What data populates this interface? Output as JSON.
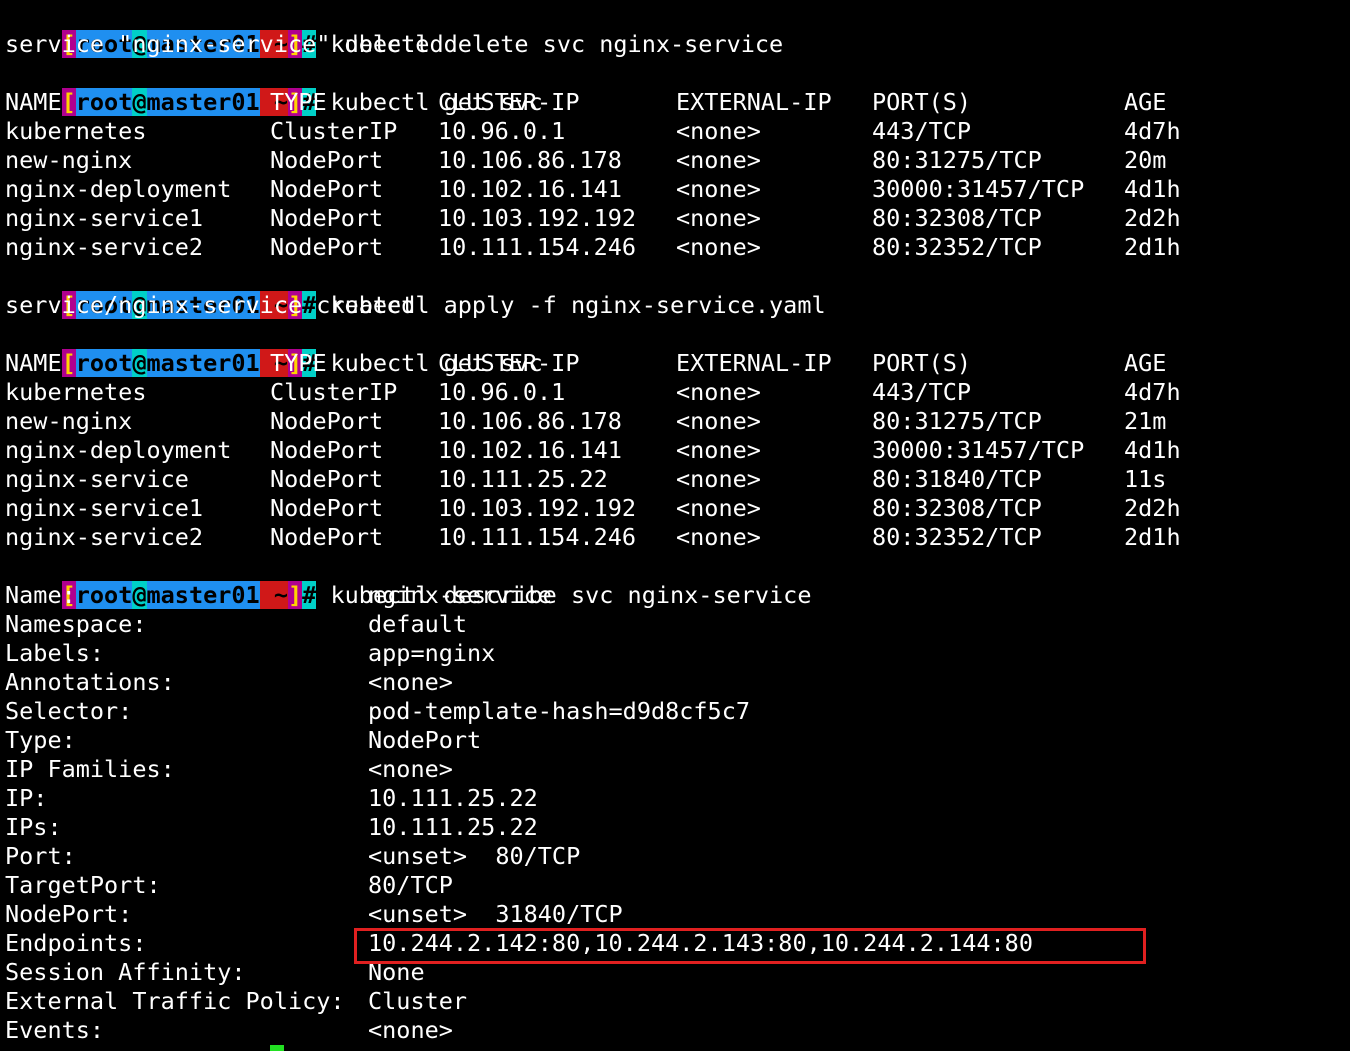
{
  "prompt": {
    "bracket_open": "[",
    "user": "root",
    "at": "@",
    "host": "master01",
    "path": " ~",
    "bracket_close": "]",
    "hash": "#"
  },
  "commands": {
    "delete": " kubectl delete svc nginx-service",
    "get1": " kubectl get svc",
    "apply": " kubectl apply -f nginx-service.yaml",
    "get2": " kubectl get svc",
    "describe": " kubectl describe svc nginx-service"
  },
  "outputs": {
    "deleted": "service \"nginx-service\" deleted",
    "created": "service/nginx-service created"
  },
  "svc_headers": [
    "NAME",
    "TYPE",
    "CLUSTER-IP",
    "EXTERNAL-IP",
    "PORT(S)",
    "AGE"
  ],
  "svc_table_1": [
    [
      "kubernetes",
      "ClusterIP",
      "10.96.0.1",
      "<none>",
      "443/TCP",
      "4d7h"
    ],
    [
      "new-nginx",
      "NodePort",
      "10.106.86.178",
      "<none>",
      "80:31275/TCP",
      "20m"
    ],
    [
      "nginx-deployment",
      "NodePort",
      "10.102.16.141",
      "<none>",
      "30000:31457/TCP",
      "4d1h"
    ],
    [
      "nginx-service1",
      "NodePort",
      "10.103.192.192",
      "<none>",
      "80:32308/TCP",
      "2d2h"
    ],
    [
      "nginx-service2",
      "NodePort",
      "10.111.154.246",
      "<none>",
      "80:32352/TCP",
      "2d1h"
    ]
  ],
  "svc_table_2": [
    [
      "kubernetes",
      "ClusterIP",
      "10.96.0.1",
      "<none>",
      "443/TCP",
      "4d7h"
    ],
    [
      "new-nginx",
      "NodePort",
      "10.106.86.178",
      "<none>",
      "80:31275/TCP",
      "21m"
    ],
    [
      "nginx-deployment",
      "NodePort",
      "10.102.16.141",
      "<none>",
      "30000:31457/TCP",
      "4d1h"
    ],
    [
      "nginx-service",
      "NodePort",
      "10.111.25.22",
      "<none>",
      "80:31840/TCP",
      "11s"
    ],
    [
      "nginx-service1",
      "NodePort",
      "10.103.192.192",
      "<none>",
      "80:32308/TCP",
      "2d2h"
    ],
    [
      "nginx-service2",
      "NodePort",
      "10.111.154.246",
      "<none>",
      "80:32352/TCP",
      "2d1h"
    ]
  ],
  "describe": [
    [
      "Name:",
      "nginx-service"
    ],
    [
      "Namespace:",
      "default"
    ],
    [
      "Labels:",
      "app=nginx"
    ],
    [
      "Annotations:",
      "<none>"
    ],
    [
      "Selector:",
      "pod-template-hash=d9d8cf5c7"
    ],
    [
      "Type:",
      "NodePort"
    ],
    [
      "IP Families:",
      "<none>"
    ],
    [
      "IP:",
      "10.111.25.22"
    ],
    [
      "IPs:",
      "10.111.25.22"
    ],
    [
      "Port:",
      "<unset>  80/TCP"
    ],
    [
      "TargetPort:",
      "80/TCP"
    ],
    [
      "NodePort:",
      "<unset>  31840/TCP"
    ],
    [
      "Endpoints:",
      "10.244.2.142:80,10.244.2.143:80,10.244.2.144:80"
    ],
    [
      "Session Affinity:",
      "None"
    ],
    [
      "External Traffic Policy:",
      "Cluster"
    ],
    [
      "Events:",
      "<none>"
    ]
  ],
  "colors": {
    "background": "#000000",
    "text": "#ffffff",
    "prompt_user_bg": "#1f8ff0",
    "prompt_at_bg": "#00d0c8",
    "prompt_path_bg": "#d01818",
    "prompt_bracket_bg": "#b0008f",
    "highlight_border": "#e02020",
    "cursor": "#22e022"
  }
}
